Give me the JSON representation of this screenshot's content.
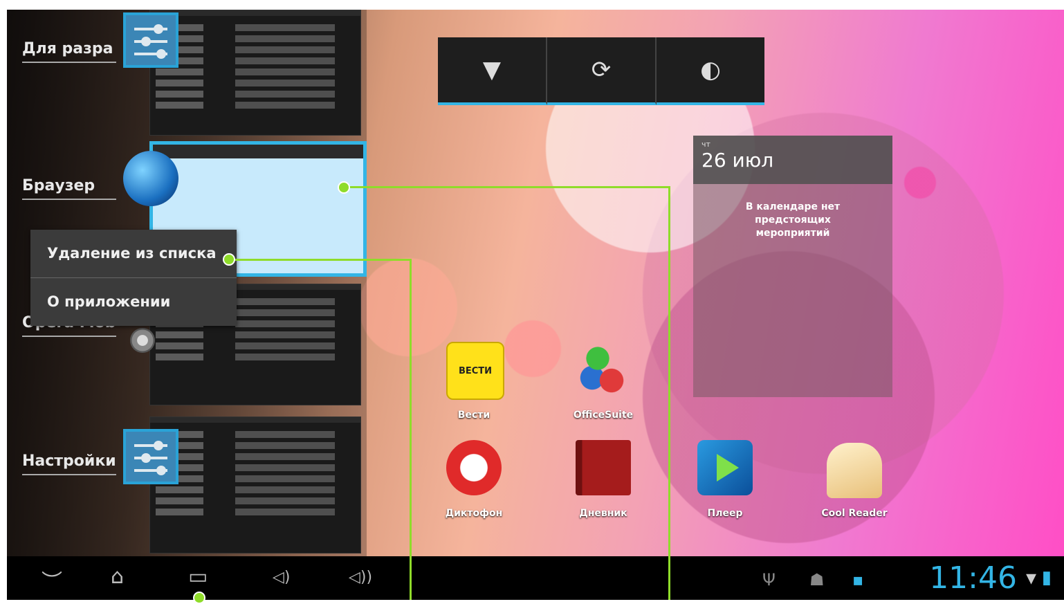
{
  "recent_apps": [
    {
      "label": "Для разра",
      "icon": "settings-sliders-icon"
    },
    {
      "label": "Браузер",
      "icon": "globe-icon"
    },
    {
      "label": "Opera Mobile",
      "icon": "gear-icon"
    },
    {
      "label": "Настройки",
      "icon": "settings-sliders-icon"
    }
  ],
  "context_menu": {
    "remove": "Удаление из списка",
    "app_info": "О приложении"
  },
  "quick_settings": {
    "wifi_icon": "wifi-icon",
    "sync_icon": "sync-icon",
    "brightness_icon": "brightness-icon",
    "wifi_glyph": "▼",
    "sync_glyph": "⟳",
    "brightness_glyph": "◐"
  },
  "calendar_widget": {
    "day": "чт",
    "date": "26 июл",
    "message": "В календаре нет предстоящих мероприятий"
  },
  "home_apps": [
    {
      "label": "Вести",
      "icon": "vesti-icon",
      "text": "ВЕСТИ",
      "color": "#ffe11a"
    },
    {
      "label": "OfficeSuite",
      "icon": "officesuite-icon",
      "color": "#e04040"
    },
    {
      "label": "Диктофон",
      "icon": "microphone-icon",
      "color": "#e02a2a"
    },
    {
      "label": "Дневник",
      "icon": "diary-icon",
      "color": "#a51c1c"
    },
    {
      "label": "Плеер",
      "icon": "play-icon",
      "color": "#1f7fd0"
    },
    {
      "label": "Cool Reader",
      "icon": "book-icon",
      "color": "#f2d59a"
    }
  ],
  "navbar": {
    "back_glyph": "︶",
    "home_glyph": "⌂",
    "recents_glyph": "▭",
    "vol_down_glyph": "◁)",
    "vol_up_glyph": "◁))",
    "usb_glyph": "Ψ",
    "android_glyph": "☗",
    "card_glyph": "▪",
    "clock": "11:46",
    "wifi_glyph": "▾",
    "battery_glyph": "▮"
  },
  "colors": {
    "accent": "#33b5e5",
    "callout": "#8fdc2a"
  }
}
